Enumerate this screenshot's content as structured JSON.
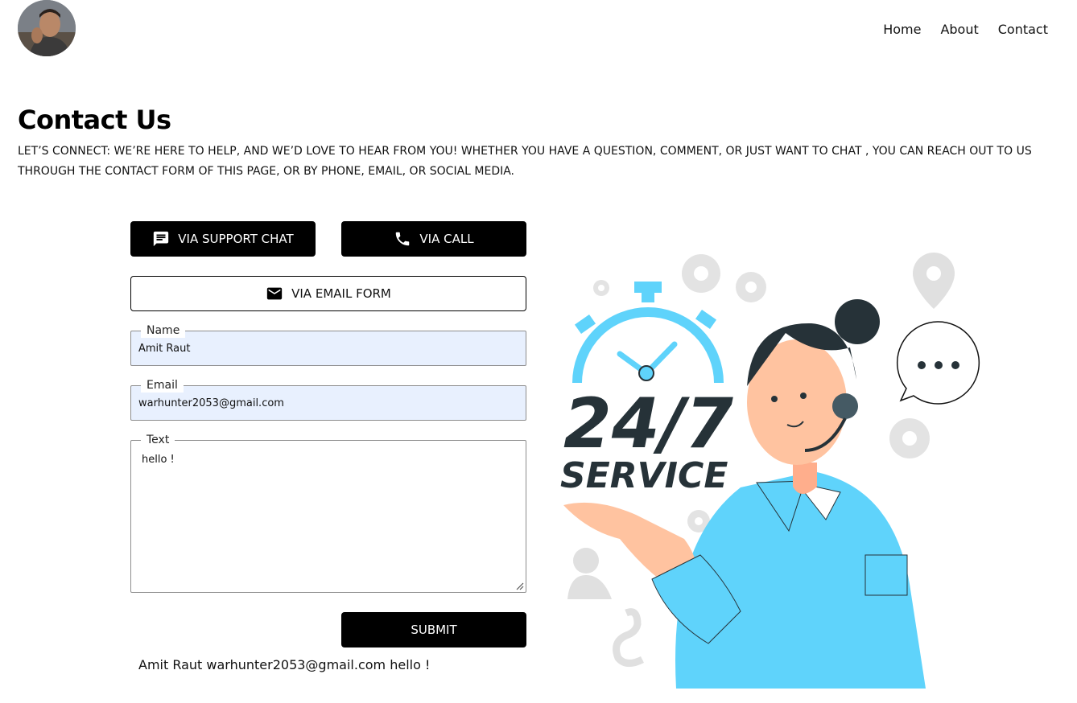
{
  "header": {
    "avatar_alt": "profile photo",
    "nav": [
      {
        "label": "Home"
      },
      {
        "label": "About"
      },
      {
        "label": "Contact"
      }
    ]
  },
  "main": {
    "title": "Contact Us",
    "intro": "LET’S CONNECT: WE’RE HERE TO HELP, AND WE’D LOVE TO HEAR FROM YOU! WHETHER YOU HAVE A QUESTION, COMMENT, OR JUST WANT TO CHAT , YOU CAN REACH OUT TO US THROUGH THE CONTACT FORM OF THIS PAGE, OR BY PHONE, EMAIL, OR SOCIAL MEDIA."
  },
  "buttons": {
    "support_chat": {
      "label": "VIA SUPPORT CHAT",
      "icon": "chat-icon"
    },
    "call": {
      "label": "VIA CALL",
      "icon": "phone-icon"
    },
    "email_form": {
      "label": "VIA EMAIL FORM",
      "icon": "mail-icon"
    },
    "submit": {
      "label": "SUBMIT"
    }
  },
  "form": {
    "name": {
      "label": "Name",
      "value": "Amit Raut"
    },
    "email": {
      "label": "Email",
      "value": "warhunter2053@gmail.com"
    },
    "text": {
      "label": "Text",
      "value": "hello !"
    }
  },
  "output": {
    "echo": "Amit Raut warhunter2053@gmail.com hello !"
  },
  "illustration": {
    "big_text": "24/7",
    "sub_text": "SERVICE"
  },
  "colors": {
    "accent_blue": "#5fd3fb",
    "dark": "#263238",
    "autofill_bg": "#e8f0fe"
  }
}
